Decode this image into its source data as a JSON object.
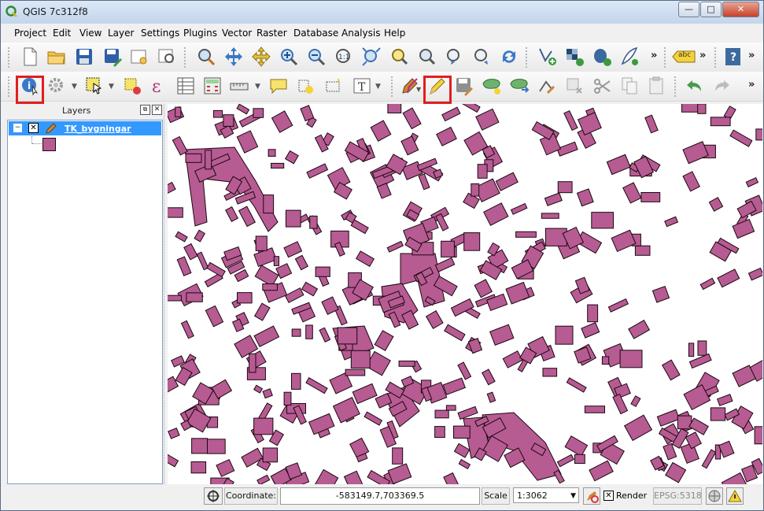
{
  "window": {
    "title": "QGIS 7c312f8",
    "controls": {
      "minimize": "—",
      "maximize": "□",
      "close": "✕"
    }
  },
  "menu": [
    "Project",
    "Edit",
    "View",
    "Layer",
    "Settings",
    "Plugins",
    "Vector",
    "Raster",
    "Database",
    "Analysis",
    "Help"
  ],
  "toolbars": {
    "overflow": "»",
    "label_tool_text": "abc"
  },
  "layers_panel": {
    "title": "Layers",
    "layer": {
      "name": "TK_bygningar",
      "checked": true,
      "fill_color": "#b75b93",
      "outline_color": "#1a0810"
    }
  },
  "status": {
    "coordinate_label": "Coordinate:",
    "coordinate_value": "-583149.7,703369.5",
    "scale_label": "Scale",
    "scale_value": "1:3062",
    "render_label": "Render",
    "render_checked": true,
    "crs": "EPSG:5318"
  },
  "colors": {
    "highlight": "#e01f1f",
    "selection": "#3399ff"
  }
}
